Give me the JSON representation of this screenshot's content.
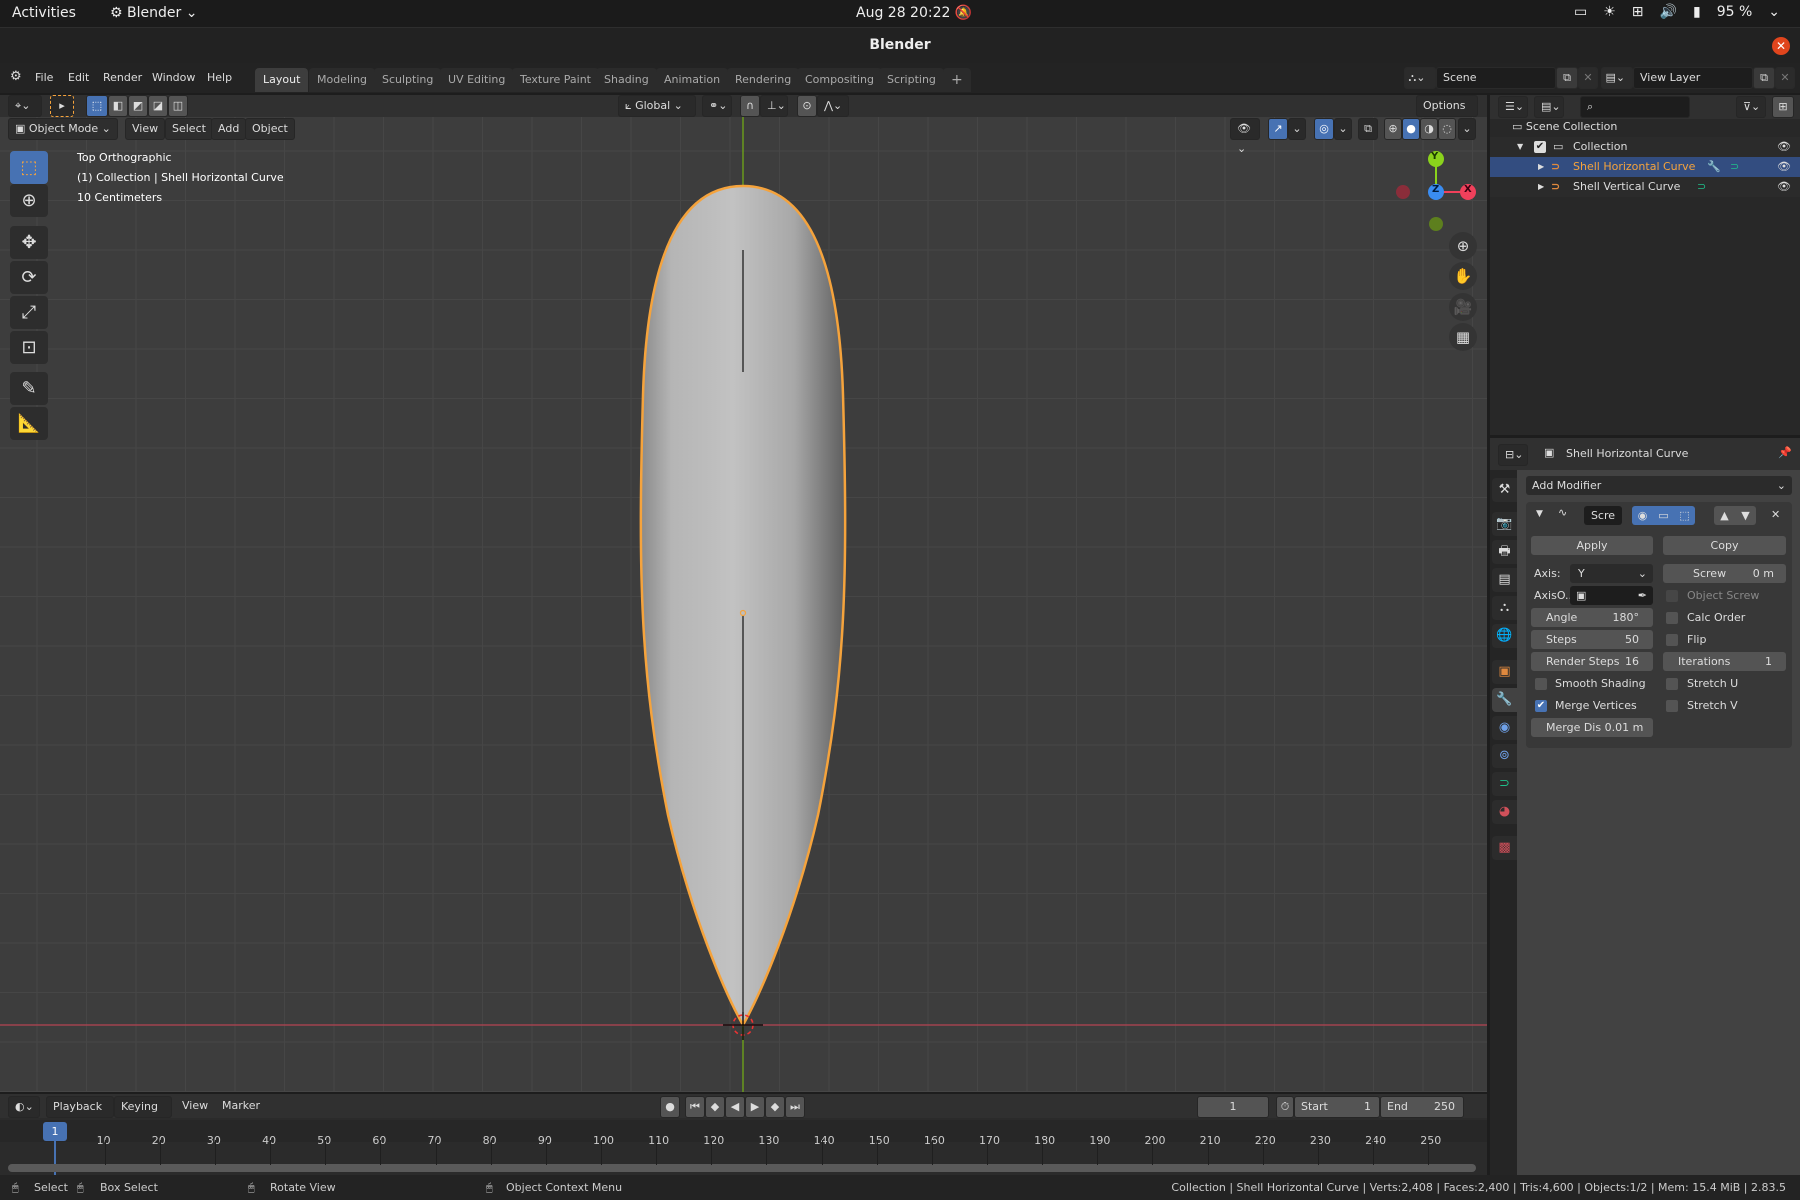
{
  "system_bar": {
    "activities": "Activities",
    "app_name": "Blender",
    "datetime": "Aug 28  20:22",
    "battery": "95 %"
  },
  "window": {
    "title": "Blender"
  },
  "menu": {
    "items": [
      "File",
      "Edit",
      "Render",
      "Window",
      "Help"
    ],
    "workspaces": [
      "Layout",
      "Modeling",
      "Sculpting",
      "UV Editing",
      "Texture Paint",
      "Shading",
      "Animation",
      "Rendering",
      "Compositing",
      "Scripting"
    ],
    "active_workspace": "Layout",
    "add_workspace": "+",
    "scene": "Scene",
    "view_layer": "View Layer"
  },
  "viewport_header": {
    "transform_orientation": "Global",
    "options": "Options",
    "mode": "Object Mode",
    "menus": [
      "View",
      "Select",
      "Add",
      "Object"
    ]
  },
  "viewport": {
    "view_name": "Top Orthographic",
    "object_info": "(1) Collection | Shell Horizontal Curve",
    "scale_info": "10 Centimeters",
    "gizmo": {
      "y": "Y",
      "z": "Z",
      "x": "X"
    }
  },
  "outliner": {
    "scene_collection": "Scene Collection",
    "collection": "Collection",
    "objects": [
      {
        "name": "Shell Horizontal Curve",
        "selected": true,
        "has_modifier": true
      },
      {
        "name": "Shell Vertical Curve",
        "selected": false,
        "has_modifier": false
      }
    ]
  },
  "properties": {
    "object_name": "Shell Horizontal Curve",
    "add_modifier": "Add Modifier",
    "modifier_name": "Scre",
    "apply": "Apply",
    "copy": "Copy",
    "axis_label": "Axis:",
    "axis_value": "Y",
    "screw_label": "Screw",
    "screw_value": "0 m",
    "axis_object_label": "AxisO...",
    "object_screw": "Object Screw",
    "angle_label": "Angle",
    "angle_value": "180°",
    "calc_order": "Calc Order",
    "steps_label": "Steps",
    "steps_value": "50",
    "flip": "Flip",
    "render_steps_label": "Render Steps",
    "render_steps_value": "16",
    "iterations_label": "Iterations",
    "iterations_value": "1",
    "smooth_shading": "Smooth Shading",
    "stretch_u": "Stretch U",
    "merge_vertices": "Merge Vertices",
    "merge_vertices_checked": true,
    "stretch_v": "Stretch V",
    "merge_dist_label": "Merge Dis",
    "merge_dist_value": "0.01 m"
  },
  "timeline": {
    "menus": [
      "Playback",
      "Keying",
      "View",
      "Marker"
    ],
    "current_frame": "1",
    "start_label": "Start",
    "start_value": "1",
    "end_label": "End",
    "end_value": "250",
    "ticks": [
      "10",
      "20",
      "30",
      "40",
      "50",
      "60",
      "70",
      "80",
      "90",
      "100",
      "110",
      "120",
      "130",
      "140",
      "150",
      "160",
      "170",
      "180",
      "190",
      "200",
      "210",
      "220",
      "230",
      "240",
      "250"
    ],
    "playhead": "1"
  },
  "status_bar": {
    "select": "Select",
    "box_select": "Box Select",
    "rotate_view": "Rotate View",
    "context_menu": "Object Context Menu",
    "stats": "Collection | Shell Horizontal Curve | Verts:2,408 | Faces:2,400 | Tris:4,600 | Objects:1/2 | Mem: 15.4 MiB | 2.83.5"
  },
  "colors": {
    "accent_blue": "#4772b3",
    "selection_orange": "#f5a33c",
    "x_axis": "#f0405b",
    "y_axis": "#8ad21c",
    "z_axis": "#3a8cf0"
  }
}
